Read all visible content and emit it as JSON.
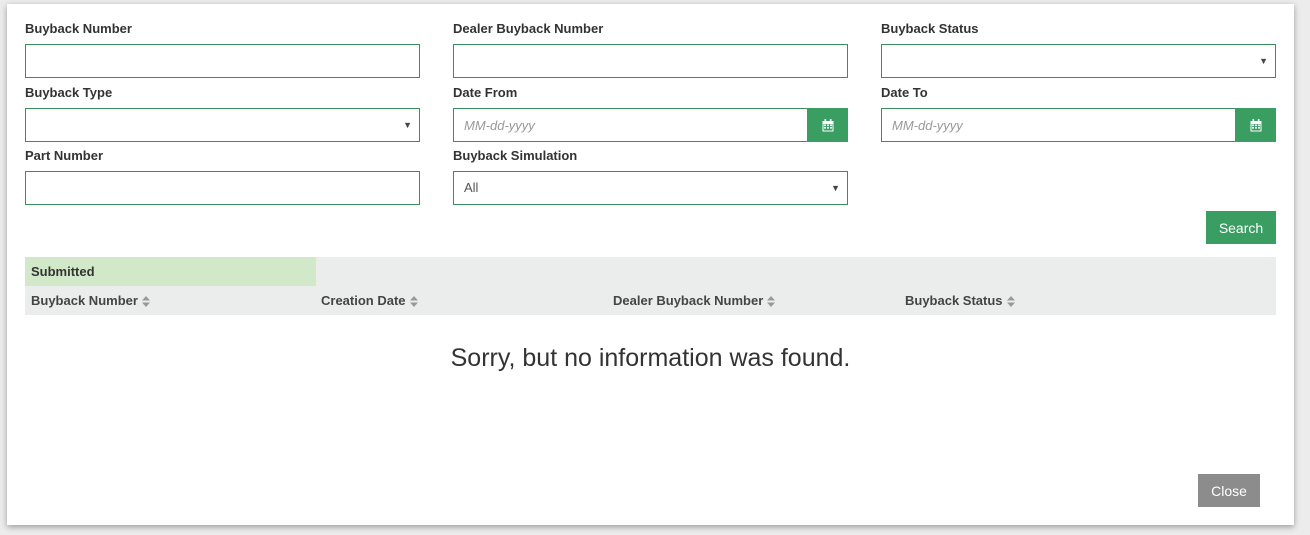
{
  "filters": {
    "buyback_number": {
      "label": "Buyback Number",
      "value": ""
    },
    "dealer_buyback_number": {
      "label": "Dealer Buyback Number",
      "value": ""
    },
    "buyback_status": {
      "label": "Buyback Status",
      "value": ""
    },
    "buyback_type": {
      "label": "Buyback Type",
      "value": ""
    },
    "date_from": {
      "label": "Date From",
      "placeholder": "MM-dd-yyyy",
      "value": ""
    },
    "date_to": {
      "label": "Date To",
      "placeholder": "MM-dd-yyyy",
      "value": ""
    },
    "part_number": {
      "label": "Part Number",
      "value": ""
    },
    "buyback_simulation": {
      "label": "Buyback Simulation",
      "value": "All"
    }
  },
  "actions": {
    "search_label": "Search",
    "close_label": "Close"
  },
  "table": {
    "tab_label": "Submitted",
    "columns": [
      "Buyback Number",
      "Creation Date",
      "Dealer Buyback Number",
      "Buyback Status"
    ],
    "empty_message": "Sorry, but no information was found."
  },
  "icons": {
    "calendar": "calendar-icon",
    "caret": "caret-down-icon",
    "sort": "sort-icon"
  },
  "colors": {
    "accent": "#3a9e63",
    "input_border": "#3a8f5c",
    "tab_bg": "#d1e9c9",
    "header_bg": "#ebedec",
    "close_bg": "#8c8c8c"
  }
}
